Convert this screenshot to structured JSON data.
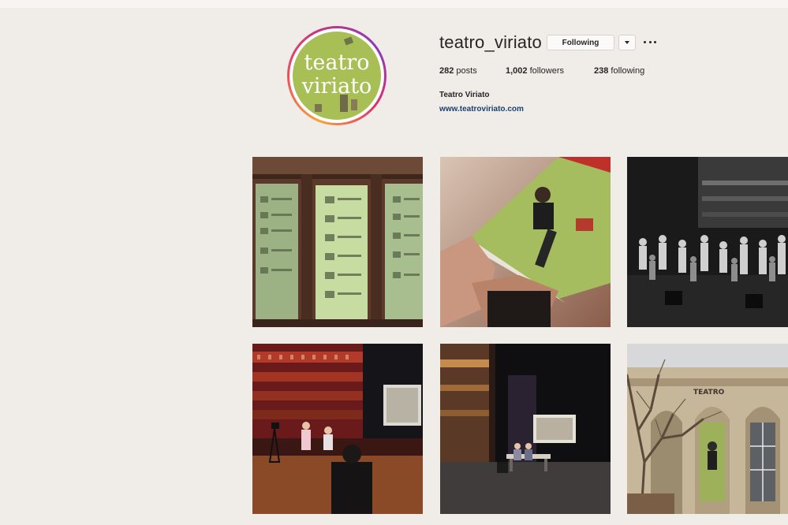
{
  "profile": {
    "username": "teatro_viriato",
    "avatar": {
      "line1": "teatro",
      "line2": "viriato"
    },
    "follow_button_label": "Following",
    "dropdown_icon": "caret-down-icon",
    "more_icon": "ellipsis-icon",
    "stats": {
      "posts_count": "282",
      "posts_label": "posts",
      "followers_count": "1,002",
      "followers_label": "followers",
      "following_count": "238",
      "following_label": "following"
    },
    "full_name": "Teatro Viriato",
    "website": "www.teatroviriato.com"
  },
  "posts": [
    {
      "subject": "lobby display panels"
    },
    {
      "subject": "hands holding programme booklet"
    },
    {
      "subject": "black and white rehearsal"
    },
    {
      "subject": "red auditorium with stage"
    },
    {
      "subject": "stage with projection screen"
    },
    {
      "subject": "theatre facade with tree"
    }
  ],
  "post6_facade_text": "TEATRO",
  "colors": {
    "brand_green": "#a6bf52",
    "link_blue": "#1a3f73",
    "background": "#f0ece8"
  }
}
